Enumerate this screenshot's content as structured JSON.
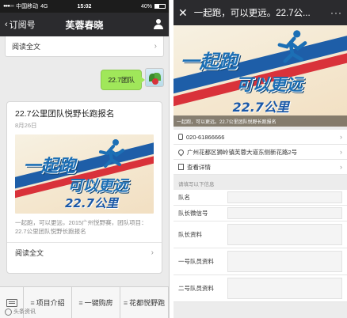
{
  "left_phone": {
    "status": {
      "carrier": "中国移动",
      "network": "4G",
      "time": "15:02",
      "battery": "40%"
    },
    "nav": {
      "back_label": "订阅号",
      "title": "芙蓉春晓"
    },
    "top_card": {
      "read_full": "阅读全文"
    },
    "sent_message": "22.7团队",
    "article": {
      "title": "22.7公里团队悦野长跑报名",
      "date": "8月26日",
      "banner_text": {
        "line1": "一起跑",
        "line2": "可以更远",
        "line3": "22.7公里"
      },
      "summary": "一起跑，可以更远，2015广州悦野赛，团队项目：22.7公里团队悦野长跑报名",
      "read_full": "阅读全文"
    },
    "menu": [
      {
        "label": "项目介绍"
      },
      {
        "label": "一键购房"
      },
      {
        "label": "花都悦野跑"
      }
    ],
    "watermark": "头条资讯"
  },
  "right_phone": {
    "nav": {
      "title": "一起跑，可以更远。22.7公..."
    },
    "banner_text": {
      "line1": "一起跑",
      "line2": "可以更远",
      "line3": "22.7公里"
    },
    "banner_caption": "一起跑，可以更远。22.7公里团队悦野长跑报名",
    "info_items": [
      {
        "icon": "phone-icon",
        "text": "020-61866666"
      },
      {
        "icon": "location-pin-icon",
        "text": "广州花都区狮岭镇芙蓉大道东侧新花路2号"
      },
      {
        "icon": "document-icon",
        "text": "查看详情"
      }
    ],
    "form_hint": "请填写以下信息",
    "form_fields": [
      {
        "label": "队名"
      },
      {
        "label": "队长微信号"
      },
      {
        "label": "队长资料"
      },
      {
        "label": "一号队员资料"
      },
      {
        "label": "二号队员资料"
      }
    ]
  },
  "colors": {
    "wechat_nav": "#2b2b2e",
    "bubble_green": "#a0e75a",
    "art_blue": "#1c6fb5",
    "art_red": "#d9323a"
  }
}
